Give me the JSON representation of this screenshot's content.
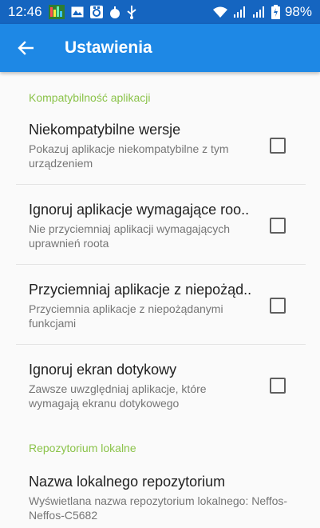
{
  "status_bar": {
    "time": "12:46",
    "battery": "98%",
    "icons": [
      "taskmanager-icon",
      "image-icon",
      "refresh-app-icon",
      "bomb-icon",
      "usb-icon",
      "wifi-icon",
      "signal-icon",
      "signal-icon",
      "battery-icon"
    ]
  },
  "toolbar": {
    "title": "Ustawienia"
  },
  "sections": [
    {
      "category": "Kompatybilność aplikacji"
    },
    {
      "category": "Repozytorium lokalne"
    }
  ],
  "prefs": [
    {
      "title": "Niekompatybilne wersje",
      "summary": "Pokazuj aplikacje niekompatybilne z tym urządzeniem",
      "checked": false
    },
    {
      "title": "Ignoruj aplikacje wymagające roo..",
      "summary": "Nie przyciemniaj aplikacji wymagających uprawnień roota",
      "checked": false
    },
    {
      "title": "Przyciemniaj aplikacje z niepożąd..",
      "summary": "Przyciemnia aplikacje z niepożądanymi funkcjami",
      "checked": false
    },
    {
      "title": "Ignoruj ekran dotykowy",
      "summary": "Zawsze uwzględniaj aplikacje, które wymagają ekranu dotykowego",
      "checked": false
    },
    {
      "title": "Nazwa lokalnego repozytorium",
      "summary": "Wyświetlana nazwa repozytorium lokalnego: Neffos-Neffos-C5682"
    }
  ],
  "colors": {
    "status_bar": "#1565c0",
    "toolbar": "#1e88e5",
    "category": "#8bc34a"
  }
}
